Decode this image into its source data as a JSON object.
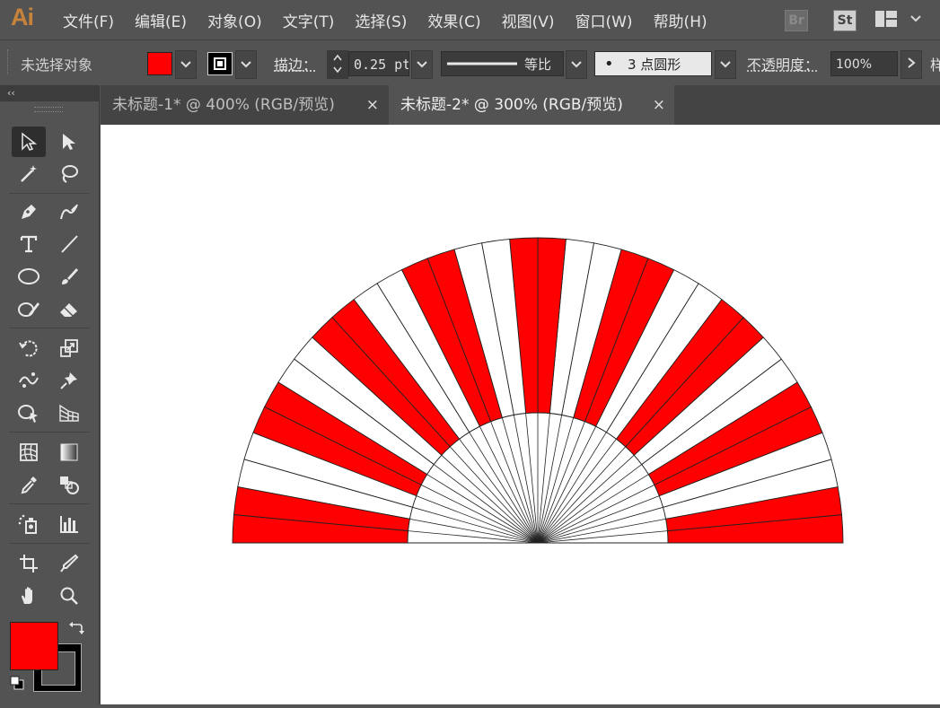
{
  "app": {
    "logo": "Ai"
  },
  "menu": [
    "文件(F)",
    "编辑(E)",
    "对象(O)",
    "文字(T)",
    "选择(S)",
    "效果(C)",
    "视图(V)",
    "窗口(W)",
    "帮助(H)"
  ],
  "bridge": {
    "br": "Br",
    "st": "St"
  },
  "control": {
    "selection_status": "未选择对象",
    "stroke_label": "描边：",
    "stroke_weight": "0.25 pt",
    "profile_label": "等比",
    "brush_label": "3 点圆形",
    "opacity_label": "不透明度：",
    "opacity_value": "100%",
    "overflow_label": "样"
  },
  "tabs": [
    {
      "label": "未标题-1* @ 400% (RGB/预览)",
      "close": "×"
    },
    {
      "label": "未标题-2* @ 300% (RGB/预览)",
      "close": "×"
    }
  ],
  "toolbar": {
    "collapse": "‹‹"
  },
  "colors": {
    "fill": "#ff0000",
    "stroke": "#000000",
    "ui": "#535353",
    "accent": "#c8833a"
  },
  "fan": {
    "outer_segments": 34,
    "inner_spokes": 34,
    "fill_pattern": "pairs of red slats alternating with pairs of white slats"
  }
}
